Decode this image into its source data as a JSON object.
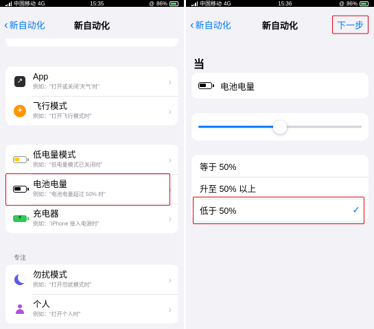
{
  "left": {
    "status": {
      "carrier": "中国移动",
      "network": "4G",
      "time": "15:35",
      "battery": "86%"
    },
    "nav": {
      "back_label": "新自动化",
      "title": "新自动化"
    },
    "group1": [
      {
        "icon": "app-icon",
        "title": "App",
        "subtitle": "例如：“打开或关闭‘天气’时”"
      },
      {
        "icon": "airplane-icon",
        "title": "飞行模式",
        "subtitle": "例如：“打开飞行模式时”"
      }
    ],
    "group2": [
      {
        "icon": "low-power-battery-icon",
        "title": "低电量模式",
        "subtitle": "例如：“低电量模式已关闭时”"
      },
      {
        "icon": "battery-icon",
        "title": "电池电量",
        "subtitle": "例如：“电池电量超过 50% 时”"
      },
      {
        "icon": "charger-icon",
        "title": "充电器",
        "subtitle": "例如：“iPhone 接入电源时”"
      }
    ],
    "focus_section_label": "专注",
    "group3": [
      {
        "icon": "moon-icon",
        "title": "勿扰模式",
        "subtitle": "例如：“打开勿扰模式时”"
      },
      {
        "icon": "person-icon",
        "title": "个人",
        "subtitle": "例如：“打开个人时”"
      }
    ]
  },
  "right": {
    "status": {
      "carrier": "中国移动",
      "network": "4G",
      "time": "15:36",
      "battery": "86%"
    },
    "nav": {
      "back_label": "新自动化",
      "title": "新自动化",
      "next_label": "下一步"
    },
    "when_heading": "当",
    "selected_trigger": "电池电量",
    "slider": {
      "level_percent": 50
    },
    "options": [
      {
        "label": "等于 50%",
        "selected": false
      },
      {
        "label": "升至 50% 以上",
        "selected": false
      },
      {
        "label": "低于 50%",
        "selected": true
      }
    ],
    "colors": {
      "accent": "#007aff",
      "highlight": "#e60012"
    }
  }
}
